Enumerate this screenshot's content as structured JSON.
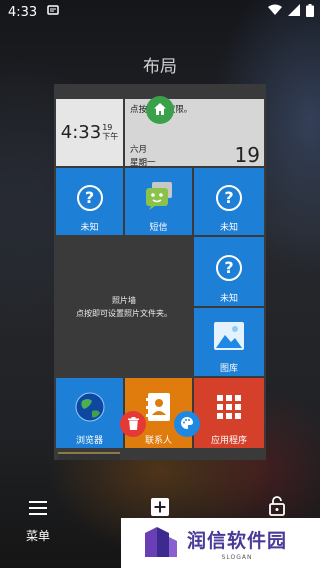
{
  "status": {
    "time": "4:33"
  },
  "page": {
    "title": "布局"
  },
  "tiles": {
    "clock": {
      "time": "4:33",
      "seconds": "19",
      "ampm": "下午"
    },
    "calendar": {
      "notice": "点按 授予权限。",
      "month": "六月",
      "weekday": "星期一",
      "day": "19"
    },
    "unknown_label": "未知",
    "sms_label": "短信",
    "photo": {
      "line1": "照片墙",
      "line2": "点按即可设置照片文件夹。"
    },
    "gallery_label": "图库",
    "browser_label": "浏览器",
    "contacts_label": "联系人",
    "apps_label": "应用程序"
  },
  "bottom": {
    "menu_label": "菜单"
  },
  "watermark": {
    "text": "润信软件园",
    "slogan": "SLOGAN"
  },
  "colors": {
    "tile_blue": "#1e7fd6",
    "tile_orange": "#e07b0e",
    "tile_red": "#d5402b",
    "fab_green": "#3aa049",
    "fab_red": "#e53935",
    "fab_blue": "#1e88e5"
  }
}
